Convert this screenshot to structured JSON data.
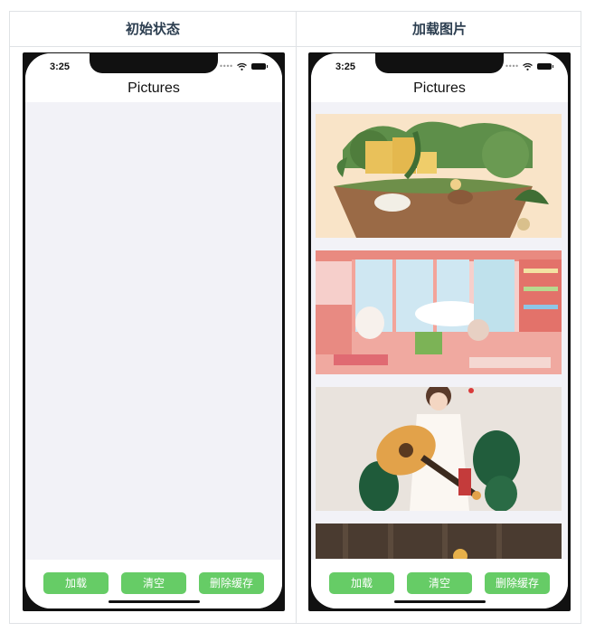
{
  "columns": {
    "left_header": "初始状态",
    "right_header": "加载图片"
  },
  "phone": {
    "time": "3:25",
    "nav_title": "Pictures",
    "buttons": {
      "load": "加载",
      "clear": "清空",
      "delete_cache": "删除缓存"
    }
  },
  "colors": {
    "button": "#66cc66",
    "screen_background": "#f2f2f7"
  },
  "images": [
    {
      "name": "garden-in-pot-illustration"
    },
    {
      "name": "pink-room-illustration"
    },
    {
      "name": "girl-with-guitar-illustration"
    },
    {
      "name": "partial-fourth-illustration"
    }
  ]
}
